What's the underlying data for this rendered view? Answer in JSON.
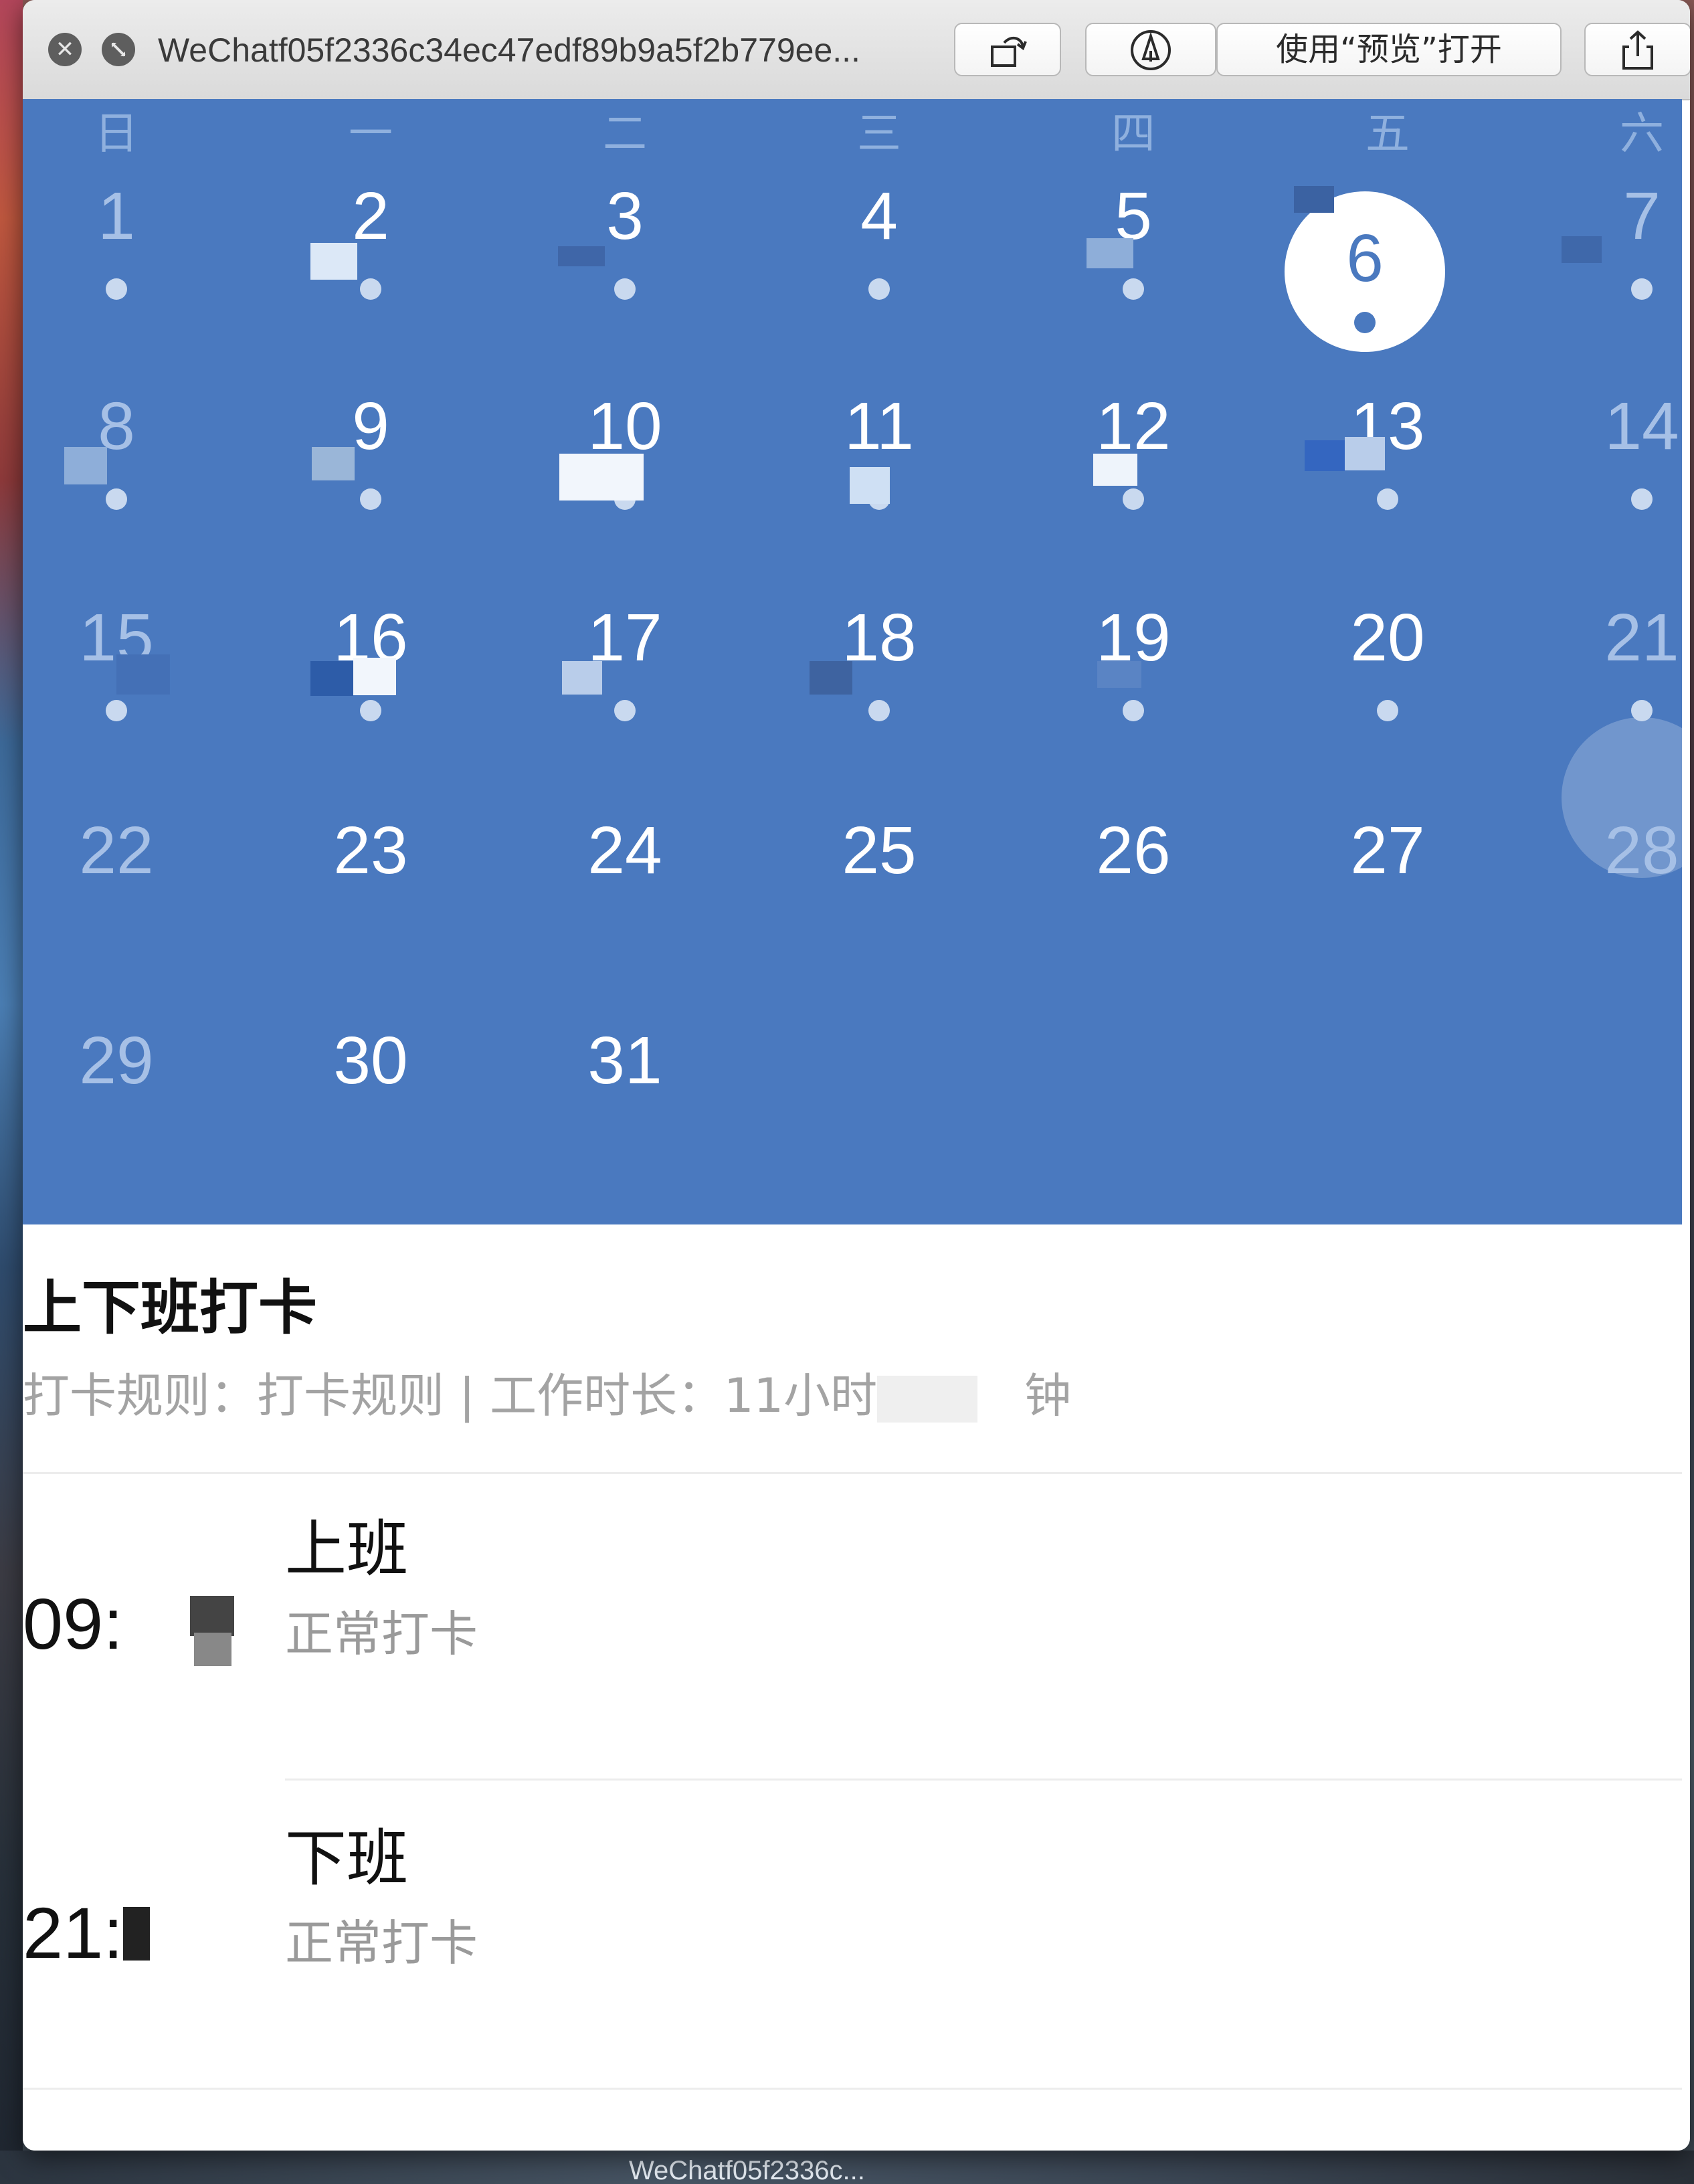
{
  "window": {
    "file_name": "WeChatf05f2336c34ec47edf89b9a5f2b779ee...",
    "open_with_preview_label": "使用“预览”打开",
    "close_icon": "close-icon",
    "fullscreen_icon": "fullscreen-icon",
    "rotate_icon": "rotate-icon",
    "markup_icon": "markup-pen-icon",
    "share_icon": "share-icon"
  },
  "calendar": {
    "weekdays": [
      "日",
      "一",
      "二",
      "三",
      "四",
      "五",
      "六"
    ],
    "today": "6",
    "weeks": [
      [
        "1",
        "2",
        "3",
        "4",
        "5",
        "6",
        "7"
      ],
      [
        "8",
        "9",
        "10",
        "11",
        "12",
        "13",
        "14"
      ],
      [
        "15",
        "16",
        "17",
        "18",
        "19",
        "20",
        "21"
      ],
      [
        "22",
        "23",
        "24",
        "25",
        "26",
        "27",
        "28"
      ],
      [
        "29",
        "30",
        "31",
        "",
        "",
        "",
        ""
      ]
    ],
    "colors": {
      "background": "#4a79bf",
      "today_circle": "#ffffff",
      "dot": "#c9d9ef"
    }
  },
  "attendance": {
    "title": "上下班打卡",
    "rule_text": "打卡规则：打卡规则 | 工作时长：11小时",
    "rule_text_suffix": "钟",
    "records": [
      {
        "time": "09:",
        "type": "上班",
        "status": "正常打卡"
      },
      {
        "time": "21:",
        "type": "下班",
        "status": "正常打卡"
      }
    ]
  },
  "desktop": {
    "label": "WeChatf05f2336c..."
  }
}
